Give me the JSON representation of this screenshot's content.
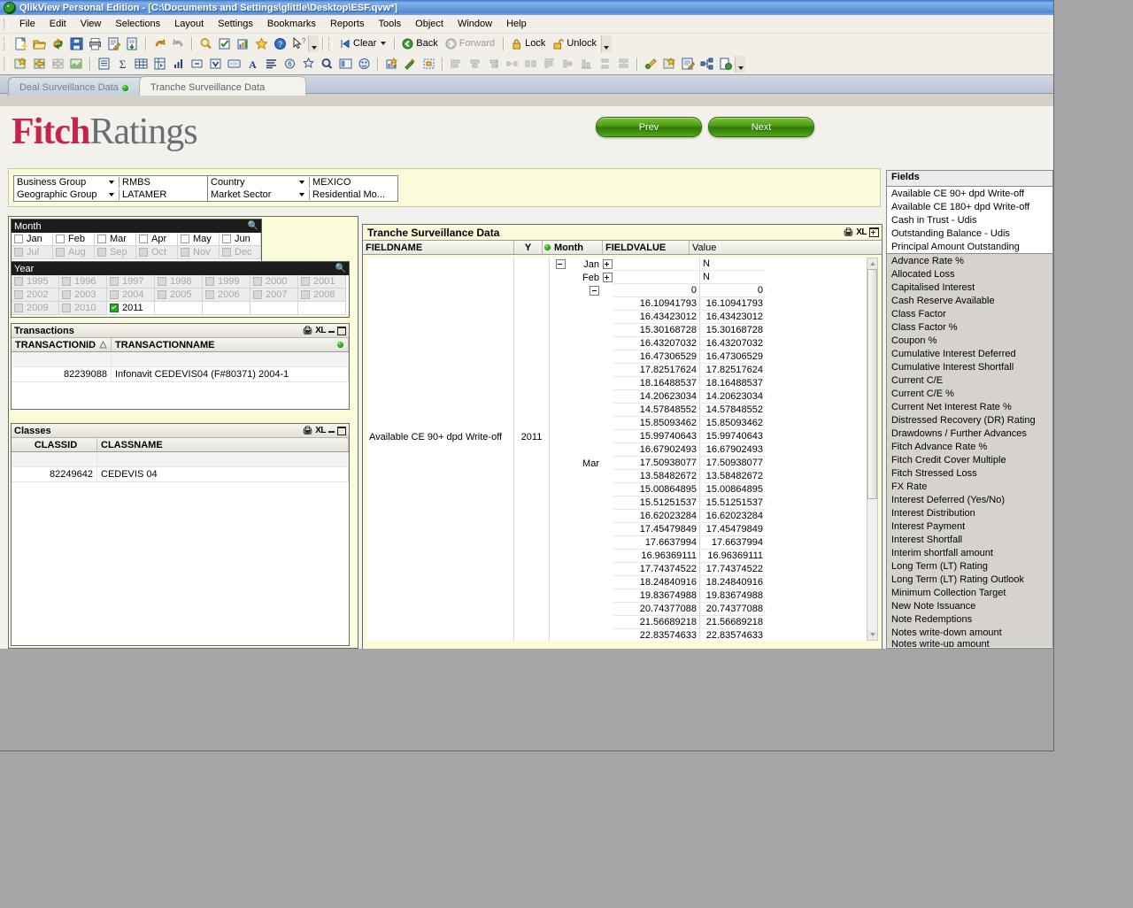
{
  "window": {
    "title": "QlikView Personal Edition - [C:\\Documents and Settings\\glittle\\Desktop\\ESF.qvw*]",
    "app_icon": "qlikview-icon"
  },
  "menu": [
    "File",
    "Edit",
    "View",
    "Selections",
    "Layout",
    "Settings",
    "Bookmarks",
    "Reports",
    "Tools",
    "Object",
    "Window",
    "Help"
  ],
  "toolbar_main": {
    "icons": [
      "new-document-icon",
      "open-folder-icon",
      "reload-icon",
      "save-icon",
      "print-icon",
      "edit-script-icon",
      "export-icon",
      "undo-icon",
      "redo-icon",
      "search-icon",
      "select-possible-icon",
      "chart-wizard-icon",
      "favorites-icon",
      "help-icon",
      "context-help-icon"
    ],
    "clear_label": "Clear",
    "back_label": "Back",
    "forward_label": "Forward",
    "lock_label": "Lock",
    "unlock_label": "Unlock"
  },
  "toolbar_design": {
    "icons": [
      "new-sheet-icon",
      "promote-sheet-icon",
      "demote-sheet-icon",
      "sheet-properties-icon",
      "list-box-icon",
      "statistics-box-icon",
      "table-box-icon",
      "pivot-table-icon",
      "chart-icon",
      "input-box-icon",
      "multi-box-icon",
      "current-selections-icon",
      "text-object-icon",
      "straight-table-icon",
      "slider-icon",
      "bookmark-object-icon",
      "search-object-icon",
      "container-icon",
      "button-icon",
      "chart-wizard-icon",
      "design-grid-icon",
      "layout-snap-icon",
      "align-left-icon",
      "align-center-icon",
      "align-right-icon",
      "distribute-h-icon",
      "space-h-icon",
      "align-top-icon",
      "align-middle-icon",
      "align-bottom-icon",
      "distribute-v-icon",
      "space-v-icon",
      "macro-icon",
      "new-object-icon",
      "edit-module-icon",
      "relationships-icon",
      "publish-icon"
    ]
  },
  "tabs": [
    {
      "label": "Deal Surveillance Data",
      "active": false,
      "has_dot": true
    },
    {
      "label": "Tranche Surveillance Data",
      "active": true,
      "has_dot": false
    }
  ],
  "brand": {
    "first": "Fitch",
    "second": "Ratings"
  },
  "nav": {
    "prev": "Prev",
    "next": "Next"
  },
  "selectors": [
    {
      "name": "business-group",
      "label": "Business Group",
      "value": "RMBS"
    },
    {
      "name": "geographic-group",
      "label": "Geographic Group",
      "value": "LATAMER"
    },
    {
      "name": "country",
      "label": "Country",
      "value": "MEXICO"
    },
    {
      "name": "market-sector",
      "label": "Market Sector",
      "value": "Residential Mo..."
    }
  ],
  "month_box": {
    "title": "Month",
    "items": [
      {
        "label": "Jan",
        "state": "possible"
      },
      {
        "label": "Feb",
        "state": "possible"
      },
      {
        "label": "Mar",
        "state": "possible"
      },
      {
        "label": "Apr",
        "state": "possible"
      },
      {
        "label": "May",
        "state": "possible"
      },
      {
        "label": "Jun",
        "state": "possible"
      },
      {
        "label": "Jul",
        "state": "excluded"
      },
      {
        "label": "Aug",
        "state": "excluded"
      },
      {
        "label": "Sep",
        "state": "excluded"
      },
      {
        "label": "Oct",
        "state": "excluded"
      },
      {
        "label": "Nov",
        "state": "excluded"
      },
      {
        "label": "Dec",
        "state": "excluded"
      }
    ]
  },
  "year_box": {
    "title": "Year",
    "items": [
      {
        "label": "1995",
        "state": "excluded"
      },
      {
        "label": "1996",
        "state": "excluded"
      },
      {
        "label": "1997",
        "state": "excluded"
      },
      {
        "label": "1998",
        "state": "excluded"
      },
      {
        "label": "1999",
        "state": "excluded"
      },
      {
        "label": "2000",
        "state": "excluded"
      },
      {
        "label": "2001",
        "state": "excluded"
      },
      {
        "label": "2002",
        "state": "excluded"
      },
      {
        "label": "2003",
        "state": "excluded"
      },
      {
        "label": "2004",
        "state": "excluded"
      },
      {
        "label": "2005",
        "state": "excluded"
      },
      {
        "label": "2006",
        "state": "excluded"
      },
      {
        "label": "2007",
        "state": "excluded"
      },
      {
        "label": "2008",
        "state": "excluded"
      },
      {
        "label": "2009",
        "state": "excluded"
      },
      {
        "label": "2010",
        "state": "excluded"
      },
      {
        "label": "2011",
        "state": "selected"
      }
    ]
  },
  "transactions": {
    "title": "Transactions",
    "columns": [
      "TRANSACTIONID",
      "TRANSACTIONNAME"
    ],
    "rows": [
      {
        "id": "82239088",
        "name": "Infonavit CEDEVIS04 (F#80371) 2004-1"
      }
    ]
  },
  "classes": {
    "title": "Classes",
    "columns": [
      "CLASSID",
      "CLASSNAME"
    ],
    "rows": [
      {
        "id": "82249642",
        "name": "CEDEVIS 04"
      }
    ]
  },
  "pivot": {
    "title": "Tranche Surveillance Data",
    "columns": [
      "FIELDNAME",
      "Y",
      "Month",
      "FIELDVALUE",
      "Value"
    ],
    "fieldname": "Available CE 90+ dpd Write-off",
    "year": "2011",
    "rows": [
      {
        "month": "Jan",
        "expand": "plus",
        "fieldvalue": "",
        "value": "N",
        "value_is_text": true
      },
      {
        "month": "Feb",
        "expand": "plus",
        "fieldvalue": "",
        "value": "N",
        "value_is_text": true
      },
      {
        "month": "",
        "expand": "minus",
        "fieldvalue": "0",
        "value": "0"
      },
      {
        "month": "",
        "fieldvalue": "16.10941793",
        "value": "16.10941793"
      },
      {
        "month": "",
        "fieldvalue": "16.43423012",
        "value": "16.43423012"
      },
      {
        "month": "",
        "fieldvalue": "15.30168728",
        "value": "15.30168728"
      },
      {
        "month": "",
        "fieldvalue": "16.43207032",
        "value": "16.43207032"
      },
      {
        "month": "",
        "fieldvalue": "16.47306529",
        "value": "16.47306529"
      },
      {
        "month": "",
        "fieldvalue": "17.82517624",
        "value": "17.82517624"
      },
      {
        "month": "",
        "fieldvalue": "18.16488537",
        "value": "18.16488537"
      },
      {
        "month": "",
        "fieldvalue": "14.20623034",
        "value": "14.20623034"
      },
      {
        "month": "",
        "fieldvalue": "14.57848552",
        "value": "14.57848552"
      },
      {
        "month": "",
        "fieldvalue": "15.85093462",
        "value": "15.85093462"
      },
      {
        "month": "",
        "fieldvalue": "15.99740643",
        "value": "15.99740643"
      },
      {
        "month": "",
        "fieldvalue": "16.67902493",
        "value": "16.67902493"
      },
      {
        "month": "Mar",
        "fieldvalue": "17.50938077",
        "value": "17.50938077"
      },
      {
        "month": "",
        "fieldvalue": "13.58482672",
        "value": "13.58482672"
      },
      {
        "month": "",
        "fieldvalue": "15.00864895",
        "value": "15.00864895"
      },
      {
        "month": "",
        "fieldvalue": "15.51251537",
        "value": "15.51251537"
      },
      {
        "month": "",
        "fieldvalue": "16.62023284",
        "value": "16.62023284"
      },
      {
        "month": "",
        "fieldvalue": "17.45479849",
        "value": "17.45479849"
      },
      {
        "month": "",
        "fieldvalue": "17.6637994",
        "value": "17.6637994"
      },
      {
        "month": "",
        "fieldvalue": "16.96369111",
        "value": "16.96369111"
      },
      {
        "month": "",
        "fieldvalue": "17.74374522",
        "value": "17.74374522"
      },
      {
        "month": "",
        "fieldvalue": "18.24840916",
        "value": "18.24840916"
      },
      {
        "month": "",
        "fieldvalue": "19.83674988",
        "value": "19.83674988"
      },
      {
        "month": "",
        "fieldvalue": "20.74377088",
        "value": "20.74377088"
      },
      {
        "month": "",
        "fieldvalue": "21.56689218",
        "value": "21.56689218"
      },
      {
        "month": "",
        "fieldvalue": "22.83574633",
        "value": "22.83574633"
      }
    ]
  },
  "fields": {
    "title": "Fields",
    "selected": [
      "Available CE 90+ dpd Write-off",
      "Available CE 180+ dpd Write-off",
      "Cash in Trust - Udis",
      "Outstanding Balance - Udis",
      "Principal Amount Outstanding"
    ],
    "available": [
      "Advance Rate %",
      "Allocated Loss",
      "Capitalised Interest",
      "Cash Reserve Available",
      "Class Factor",
      "Class Factor %",
      "Coupon %",
      "Cumulative Interest Deferred",
      "Cumulative Interest Shortfall",
      "Current C/E",
      "Current C/E %",
      "Current Net Interest Rate %",
      "Distressed Recovery (DR) Rating",
      "Drawdowns / Further Advances",
      "Fitch Advance Rate %",
      "Fitch Credit Cover Multiple",
      "Fitch Stressed Loss",
      "FX Rate",
      "Interest Deferred (Yes/No)",
      "Interest Distribution",
      "Interest Payment",
      "Interest Shortfall",
      "Interim shortfall amount",
      "Long Term (LT) Rating",
      "Long Term (LT) Rating Outlook",
      "Minimum Collection Target",
      "New Note Issuance",
      "Note Redemptions",
      "Notes write-down amount",
      "Notes write-up amount"
    ]
  },
  "panel_caps": {
    "print": "print-icon",
    "excel": "XL",
    "minimize": "minimize-icon",
    "maximize": "maximize-icon"
  },
  "colors": {
    "title_blue": "#4f8ad4",
    "brand_red": "#c8234a",
    "brand_grey": "#6b6f75",
    "button_green": "#4e9e16",
    "panel_yellow": "#fbfbd9",
    "workspace_grey": "#a6a6a6"
  }
}
